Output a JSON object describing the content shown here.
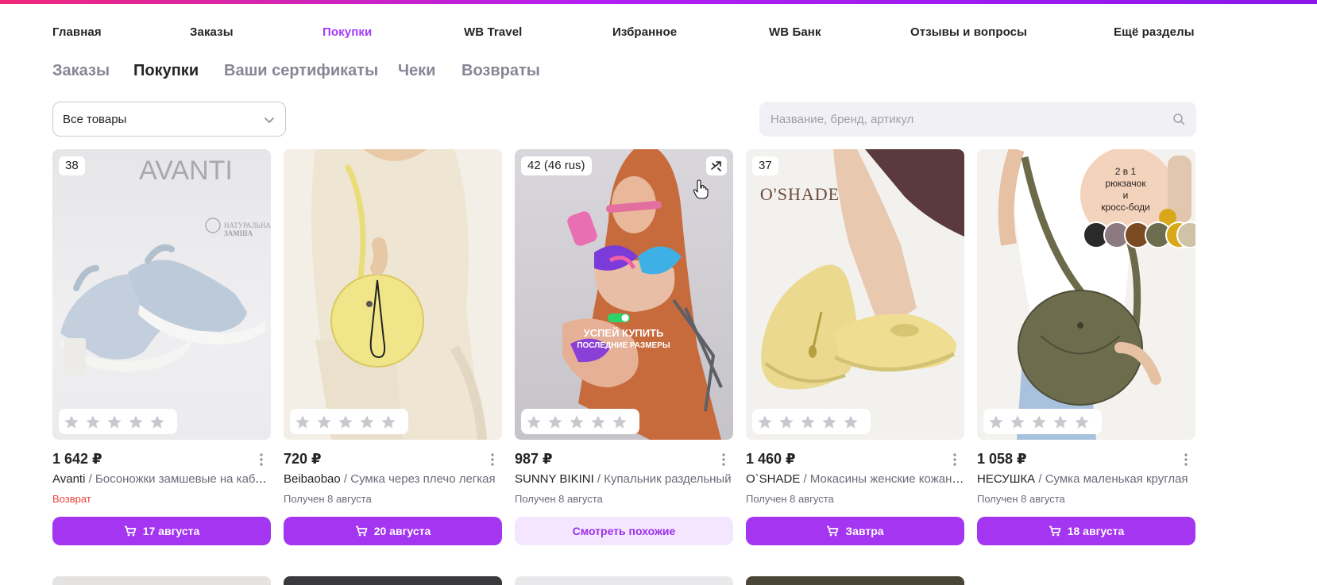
{
  "nav": {
    "items": [
      "Главная",
      "Заказы",
      "Покупки",
      "WB Travel",
      "Избранное",
      "WB Банк",
      "Отзывы и вопросы",
      "Ещё разделы"
    ],
    "active": "Покупки"
  },
  "tabs": {
    "items": [
      "Заказы",
      "Покупки",
      "Ваши сертификаты",
      "Чеки",
      "Возвраты"
    ],
    "active": "Покупки"
  },
  "filter": {
    "value": "Все товары"
  },
  "search": {
    "placeholder": "Название, бренд, артикул"
  },
  "colors": {
    "accent": "#a435f0",
    "nav_active": "#a73afd",
    "return_red": "#e8443c"
  },
  "products": [
    {
      "size": "38",
      "price": "1 642 ₽",
      "brand": "Avanti",
      "name": " / Босоножки замшевые на каблуке",
      "status": "Возврат",
      "button": "17 августа",
      "image": {
        "logo": "AVANTI",
        "badge_line1": "НАТУРАЛЬНАЯ",
        "badge_line2": "ЗАМША"
      },
      "rating": 0
    },
    {
      "size": "",
      "price": "720 ₽",
      "brand": "Beibaobao",
      "name": " / Сумка через плечо легкая",
      "status": "Получен 8 августа",
      "button": "20 августа",
      "image": {},
      "rating": 0
    },
    {
      "size": "42 (46 rus)",
      "price": "987 ₽",
      "brand": "SUNNY BIKINI",
      "name": " / Купальник раздельный",
      "status": "Получен 8 августа",
      "button": "Смотреть похожие",
      "image": {
        "promo_line1": "УСПЕЙ КУПИТЬ",
        "promo_line2": "ПОСЛЕДНИЕ РАЗМЕРЫ"
      },
      "rating": 0
    },
    {
      "size": "37",
      "price": "1 460 ₽",
      "brand": "O`SHADE",
      "name": " / Мокасины женские кожаные",
      "status": "Получен 8 августа",
      "button": "Завтра",
      "image": {
        "logo": "O'SHADE"
      },
      "rating": 0
    },
    {
      "size": "",
      "price": "1 058 ₽",
      "brand": "НЕСУШКА",
      "name": " / Сумка маленькая круглая",
      "status": "Получен 8 августа",
      "button": "18 августа",
      "image": {
        "promo_line1": "2 в 1",
        "promo_line2": "рюкзачок",
        "promo_line3": "и",
        "promo_line4": "кросс-боди"
      },
      "rating": 0
    }
  ]
}
